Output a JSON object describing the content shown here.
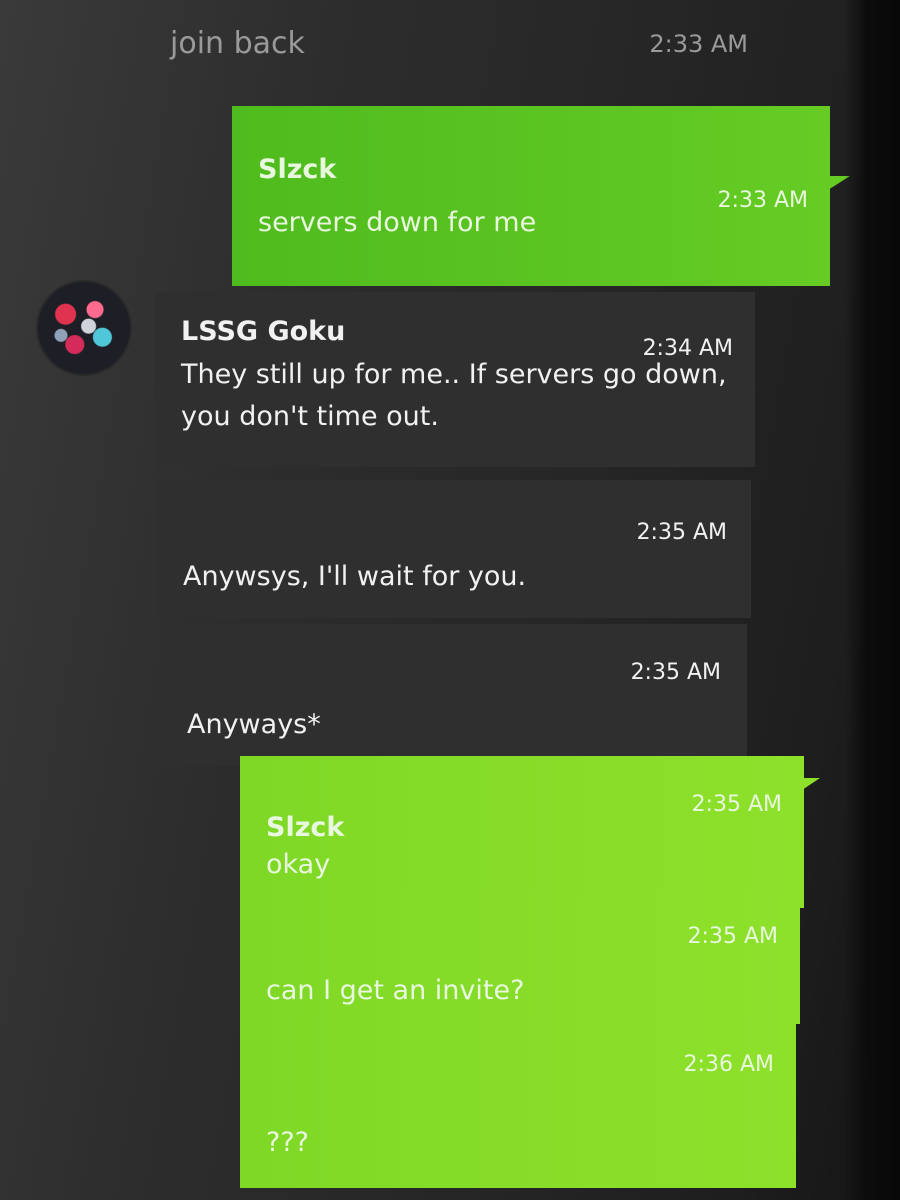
{
  "previous": {
    "text": "join back",
    "time": "2:33 AM"
  },
  "messages": [
    {
      "sender": "Slzck",
      "text": "servers down for me",
      "time": "2:33 AM"
    },
    {
      "sender": "LSSG Goku",
      "text": "They still up for me.. If servers go down, you don't time out.",
      "time": "2:34 AM"
    },
    {
      "text": "Anywsys, I'll wait for you.",
      "time": "2:35 AM"
    },
    {
      "text": "Anyways*",
      "time": "2:35 AM"
    },
    {
      "sender": "Slzck",
      "text": "okay",
      "time": "2:35 AM"
    },
    {
      "text": "can I get an invite?",
      "time": "2:35 AM"
    },
    {
      "text": "???",
      "time": "2:36 AM"
    }
  ],
  "colors": {
    "outgoing_bubble": "#5cc520",
    "outgoing_bubble_light": "#86dd29",
    "incoming_bubble": "#2f2f2f",
    "background": "#2a2a2a"
  },
  "avatar": {
    "icon": "user-avatar-image"
  }
}
